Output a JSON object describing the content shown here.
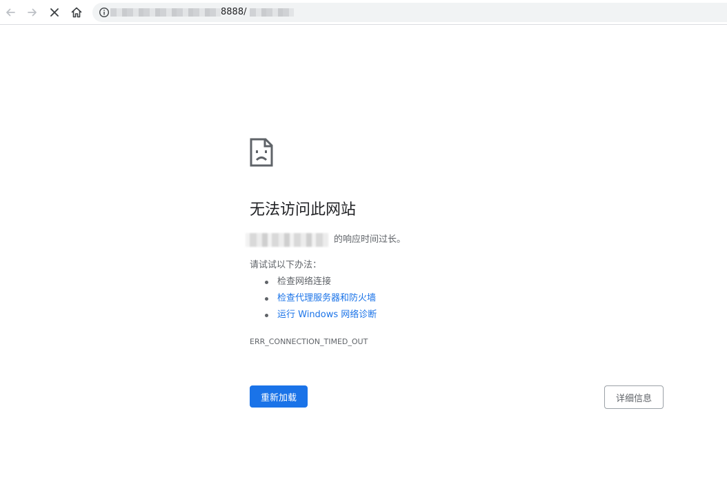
{
  "browser": {
    "url_visible_fragment": "8888/",
    "icons": {
      "back": "arrow-left-icon",
      "forward": "arrow-right-icon",
      "stop": "close-icon",
      "home": "home-icon",
      "info": "info-icon"
    }
  },
  "error_page": {
    "icon": "sad-document-icon",
    "title": "无法访问此网站",
    "host_suffix": "的响应时间过长。",
    "suggest_label": "请试试以下办法：",
    "suggestions": [
      {
        "label": "检查网络连接",
        "link": false
      },
      {
        "label": "检查代理服务器和防火墙",
        "link": true
      },
      {
        "label": "运行 Windows 网络诊断",
        "link": true
      }
    ],
    "error_code": "ERR_CONNECTION_TIMED_OUT",
    "reload_label": "重新加载",
    "details_label": "详细信息"
  },
  "colors": {
    "accent": "#1a73e8",
    "secondary_text": "#5f6368",
    "primary_text": "#202124",
    "omnibox_bg": "#f1f3f4"
  }
}
